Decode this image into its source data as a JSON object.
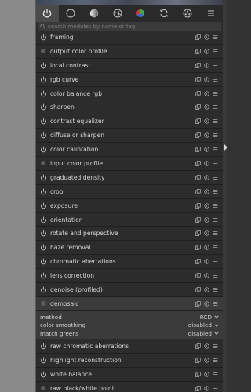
{
  "search": {
    "placeholder": "search modules by name or tag"
  },
  "tabs": [
    {
      "icon": "power-icon",
      "active": true
    },
    {
      "icon": "circle-icon",
      "active": false
    },
    {
      "icon": "tone-circle-icon",
      "active": false
    },
    {
      "icon": "aperture-icon",
      "active": false
    },
    {
      "icon": "color-wheel-icon",
      "active": false
    },
    {
      "icon": "refresh-icon",
      "active": false
    },
    {
      "icon": "film-reel-icon",
      "active": false
    },
    {
      "icon": "menu-icon",
      "active": false
    }
  ],
  "modules_top": [
    {
      "name": "framing",
      "state": "power"
    },
    {
      "name": "output color profile",
      "state": "dot"
    },
    {
      "name": "local contrast",
      "state": "power"
    },
    {
      "name": "rgb curve",
      "state": "power"
    },
    {
      "name": "color balance rgb",
      "state": "power"
    },
    {
      "name": "sharpen",
      "state": "power"
    },
    {
      "name": "contrast equalizer",
      "state": "power"
    },
    {
      "name": "diffuse or sharpen",
      "state": "power"
    },
    {
      "name": "color calibration",
      "state": "power"
    },
    {
      "name": "input color profile",
      "state": "dot"
    },
    {
      "name": "graduated density",
      "state": "power"
    },
    {
      "name": "crop",
      "state": "power"
    },
    {
      "name": "exposure",
      "state": "power"
    },
    {
      "name": "orientation",
      "state": "power"
    },
    {
      "name": "rotate and perspective",
      "state": "power"
    },
    {
      "name": "haze removal",
      "state": "power"
    },
    {
      "name": "chromatic aberrations",
      "state": "power"
    },
    {
      "name": "lens correction",
      "state": "power"
    },
    {
      "name": "denoise (profiled)",
      "state": "power"
    }
  ],
  "expanded_module": {
    "name": "demosaic",
    "state": "dot",
    "params": [
      {
        "label": "method",
        "value": "RCD"
      },
      {
        "label": "color smoothing",
        "value": "disabled"
      },
      {
        "label": "match greens",
        "value": "disabled"
      }
    ]
  },
  "modules_bottom": [
    {
      "name": "raw chromatic aberrations",
      "state": "power"
    },
    {
      "name": "highlight reconstruction",
      "state": "power"
    },
    {
      "name": "white balance",
      "state": "power"
    },
    {
      "name": "raw black/white point",
      "state": "dot"
    }
  ],
  "colors": {
    "panel_bg": "#2b2b2b",
    "row_bg": "#2c2c2c",
    "expanded_bg": "#3b3b3b",
    "left_strip": "#8a8a8a",
    "text": "#d6d6d6"
  }
}
